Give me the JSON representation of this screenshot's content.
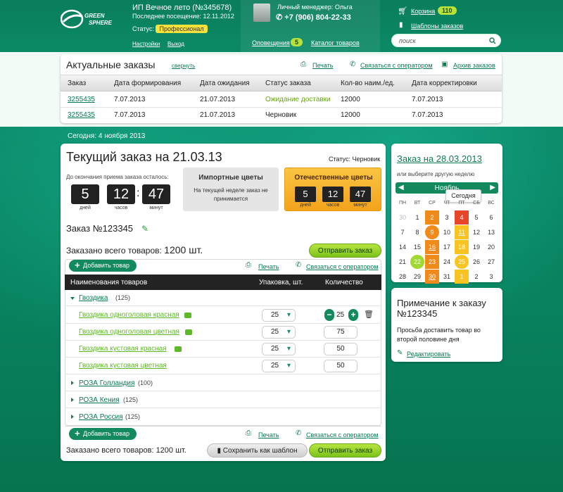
{
  "header": {
    "logo_text": "GREEN SPHERE",
    "company": "ИП Вечное лето (№345678)",
    "last_visit": "Последнее посещение: 12.11.2012",
    "status_label": "Статус:",
    "status_value": "Профессионал",
    "settings": "Настройки",
    "logout": "Выход",
    "manager": "Личный менеджер: Ольга",
    "phone": "+7 (906) 804-22-33",
    "notifications": "Оповещения",
    "notifications_count": "5",
    "catalog": "Каталог товаров",
    "cart": "Корзина",
    "cart_count": "110",
    "templates": "Шаблоны заказов",
    "search_placeholder": "поиск"
  },
  "actual_orders": {
    "title": "Актуальные заказы",
    "collapse": "свернуть",
    "print": "Печать",
    "contact_operator": "Связаться с оператором",
    "archive": "Архив заказов",
    "columns": [
      "Заказ",
      "Дата формирования",
      "Дата ожидания",
      "Статус заказа",
      "Кол-во наим./ед.",
      "Дата корректировки"
    ],
    "rows": [
      [
        "3255435",
        "7.07.2013",
        "21.07.2013",
        "Ожидание доставки",
        "12000",
        "7.07.2013"
      ],
      [
        "3255435",
        "7.07.2013",
        "21.07.2013",
        "Черновик",
        "12000",
        "7.07.2013"
      ]
    ]
  },
  "today": "Сегодня: 4 ноября 2013",
  "current_order": {
    "title": "Текущий заказ на 21.03.13",
    "status": "Статус: Черновик",
    "deadline_label": "До окончания приема заказа осталось:",
    "timer": {
      "days": "5",
      "hours": "12",
      "minutes": "47",
      "days_label": "дней",
      "hours_label": "часов",
      "minutes_label": "минут"
    },
    "import_title": "Импортные цветы",
    "import_text": "На текущей неделе заказ не принимается",
    "domestic_title": "Отечественные цветы",
    "domestic_timer": {
      "days": "5",
      "hours": "12",
      "minutes": "47",
      "days_label": "дней",
      "hours_label": "часов",
      "minutes_label": "минут"
    },
    "order_number": "Заказ №123345",
    "total_label": "Заказано всего товаров:",
    "total_value": "1200 шт.",
    "send_button": "Отправить заказ",
    "add_button": "Добавить товар",
    "print": "Печать",
    "contact_operator": "Связаться с оператором",
    "col_name": "Наименования товаров",
    "col_pack": "Упаковка, шт.",
    "col_qty": "Количество",
    "groups": [
      {
        "name": "Гвоздика",
        "count": "(125)"
      },
      {
        "name": "РОЗА Голландия",
        "count": "(100)"
      },
      {
        "name": "РОЗА Кения",
        "count": "(125)"
      },
      {
        "name": "РОЗА Россия",
        "count": "(125)"
      }
    ],
    "items": [
      {
        "name": "Гвоздика одноголовая красная",
        "pack": "25",
        "qty": "25"
      },
      {
        "name": "Гвоздика одноголовая цветная",
        "pack": "25",
        "qty": "75"
      },
      {
        "name": "Гвоздика кустовая красная",
        "pack": "25",
        "qty": "50"
      },
      {
        "name": "Гвоздика кустовая цветная",
        "pack": "25",
        "qty": "50"
      }
    ],
    "bottom_total": "Заказано всего товаров: 1200 шт.",
    "save_template": "Сохранить как шаблон"
  },
  "calendar": {
    "title": "Заказ на 28.03.2013",
    "subtitle": "или выберите другую неделю",
    "month": "Ноябрь",
    "tooltip": "Сегодня",
    "weekdays": [
      "ПН",
      "ВТ",
      "СР",
      "ЧТ",
      "ПТ",
      "СБ",
      "ВС"
    ],
    "weeks": [
      [
        "30",
        "1",
        "2",
        "3",
        "4",
        "5",
        "6"
      ],
      [
        "7",
        "8",
        "9",
        "10",
        "11",
        "12",
        "13"
      ],
      [
        "14",
        "15",
        "16",
        "17",
        "18",
        "19",
        "20"
      ],
      [
        "21",
        "22",
        "23",
        "24",
        "25",
        "26",
        "27"
      ],
      [
        "28",
        "29",
        "30",
        "31",
        "1",
        "2",
        "3"
      ]
    ]
  },
  "note": {
    "title": "Примечание к заказу №123345",
    "text": "Просьба доставить товар во второй половине дня",
    "edit": "Редактировать"
  },
  "colors": {
    "accent": "#0a7d5c",
    "lime": "#9fd82f",
    "orange": "#f08a1a",
    "yellow": "#f9c322",
    "red": "#e8462a"
  }
}
